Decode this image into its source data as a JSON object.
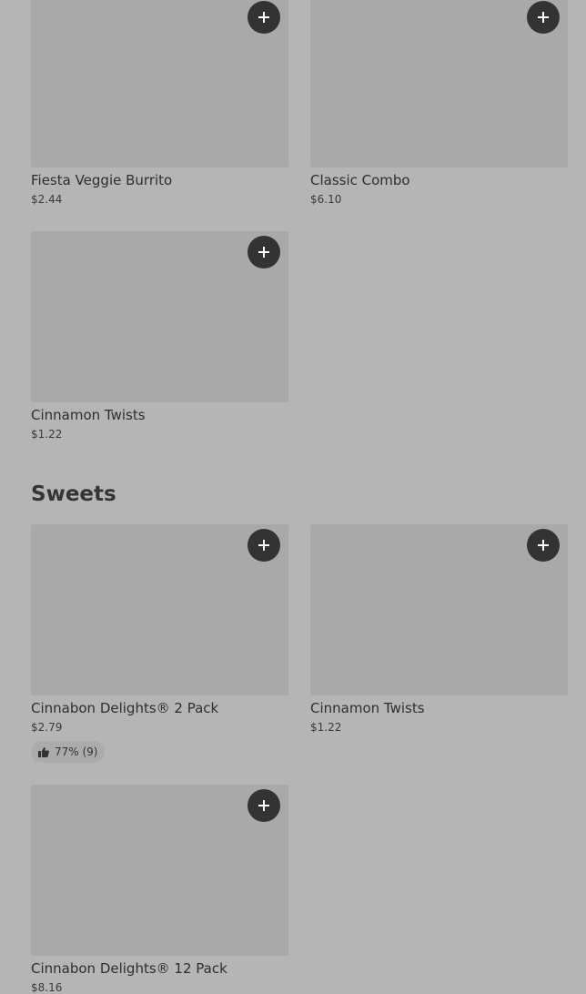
{
  "section1": {
    "items": [
      {
        "name": "Fiesta Veggie Burrito",
        "price": "$2.44"
      },
      {
        "name": "Classic Combo",
        "price": "$6.10"
      },
      {
        "name": "Cinnamon Twists",
        "price": "$1.22"
      }
    ]
  },
  "sweets": {
    "title": "Sweets",
    "items": [
      {
        "name": "Cinnabon Delights® 2 Pack",
        "price": "$2.79",
        "rating": "77% (9)"
      },
      {
        "name": "Cinnamon Twists",
        "price": "$1.22"
      },
      {
        "name": "Cinnabon Delights® 12 Pack",
        "price": "$8.16"
      }
    ]
  },
  "icons": {
    "add": "plus-icon",
    "rating": "thumbs-up-icon"
  },
  "colors": {
    "background": "#b5b5b5",
    "image_placeholder": "#a9a9a9",
    "add_button": "#333333"
  }
}
